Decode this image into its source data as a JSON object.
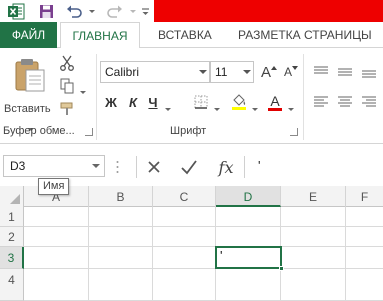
{
  "app": {
    "name": "Microsoft Excel",
    "accent_color": "#217346",
    "title_bar_redaction_color": "#ee0000"
  },
  "quick_access": {
    "icons": [
      "excel-logo-icon",
      "save-icon",
      "undo-icon",
      "redo-icon",
      "customize-qat-icon"
    ]
  },
  "tabs": {
    "file": "ФАЙЛ",
    "home": "ГЛАВНАЯ",
    "insert": "ВСТАВКА",
    "page_layout": "РАЗМЕТКА СТРАНИЦЫ"
  },
  "ribbon": {
    "clipboard": {
      "paste_label": "Вставить",
      "group_label": "Буфер обме..."
    },
    "font": {
      "font_name": "Calibri",
      "font_size": "11",
      "bold": "Ж",
      "italic": "К",
      "underline": "Ч",
      "increase_size_glyph": "A",
      "decrease_size_glyph": "A",
      "font_color_glyph": "A",
      "font_color": "#e00000",
      "group_label": "Шрифт"
    }
  },
  "formula_bar": {
    "name_box": "D3",
    "name_box_tooltip": "Имя",
    "fx_label": "fx",
    "formula_value": "'"
  },
  "grid": {
    "columns": [
      "A",
      "B",
      "C",
      "D",
      "E",
      "F"
    ],
    "rows": [
      "1",
      "2",
      "3",
      "4"
    ],
    "selected_column": "D",
    "selected_row": "3",
    "active_cell_value": "'"
  }
}
